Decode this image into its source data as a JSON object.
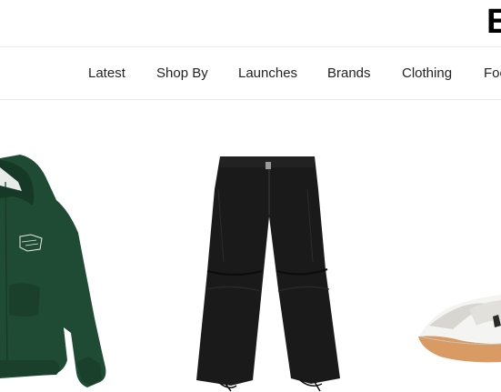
{
  "header": {
    "logo_text": "E"
  },
  "nav": {
    "items": [
      {
        "label": "Latest"
      },
      {
        "label": "Shop By"
      },
      {
        "label": "Launches"
      },
      {
        "label": "Brands"
      },
      {
        "label": "Clothing"
      },
      {
        "label": "Foo"
      }
    ]
  },
  "products": [
    {
      "name": "green-zip-hoodie",
      "color": "#1f4a33"
    },
    {
      "name": "black-cargo-pants",
      "color": "#1a1a1a"
    },
    {
      "name": "white-grey-sneaker",
      "color": "#f2f2f0"
    }
  ],
  "colors": {
    "border": "#ececec",
    "nav_text": "#222222",
    "gum_sole": "#d99a63"
  }
}
